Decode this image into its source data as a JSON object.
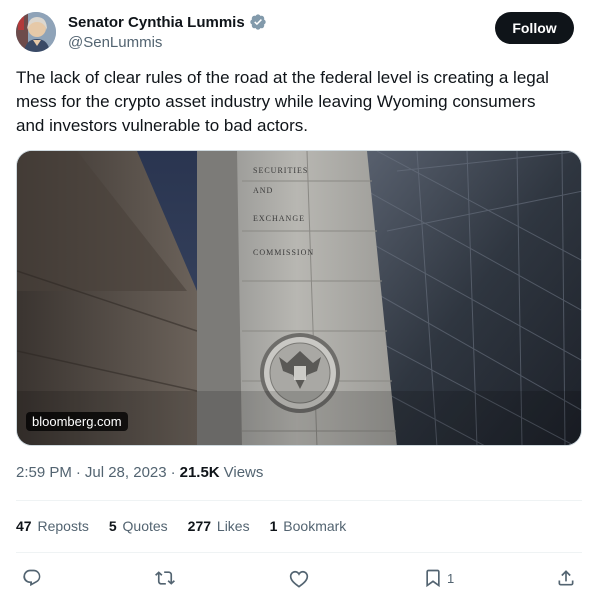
{
  "author": {
    "display_name": "Senator Cynthia Lummis",
    "handle": "@SenLummis",
    "verified": true
  },
  "follow_label": "Follow",
  "tweet": {
    "text_line1": "The lack of clear rules of the road at the federal level is creating a legal",
    "text_line2": "mess for the crypto asset industry while leaving Wyoming consumers",
    "text_line3": "and investors vulnerable to bad actors."
  },
  "media": {
    "source_label": "bloomberg.com",
    "building_text": [
      "SECURITIES",
      "AND",
      "EXCHANGE",
      "COMMISSION"
    ]
  },
  "meta": {
    "time": "2:59 PM",
    "date": "Jul 28, 2023",
    "views_count": "21.5K",
    "views_label": "Views"
  },
  "stats": {
    "reposts_count": "47",
    "reposts_label": "Reposts",
    "quotes_count": "5",
    "quotes_label": "Quotes",
    "likes_count": "277",
    "likes_label": "Likes",
    "bookmarks_count": "1",
    "bookmarks_label": "Bookmark"
  },
  "actions": {
    "bookmark_count": "1"
  },
  "colors": {
    "text_primary": "#0f1419",
    "text_secondary": "#536471",
    "verified": "#829aab",
    "follow_bg": "#0f1419"
  },
  "icons": [
    "verified-badge-icon",
    "reply-icon",
    "repost-icon",
    "like-icon",
    "bookmark-icon",
    "share-icon"
  ]
}
